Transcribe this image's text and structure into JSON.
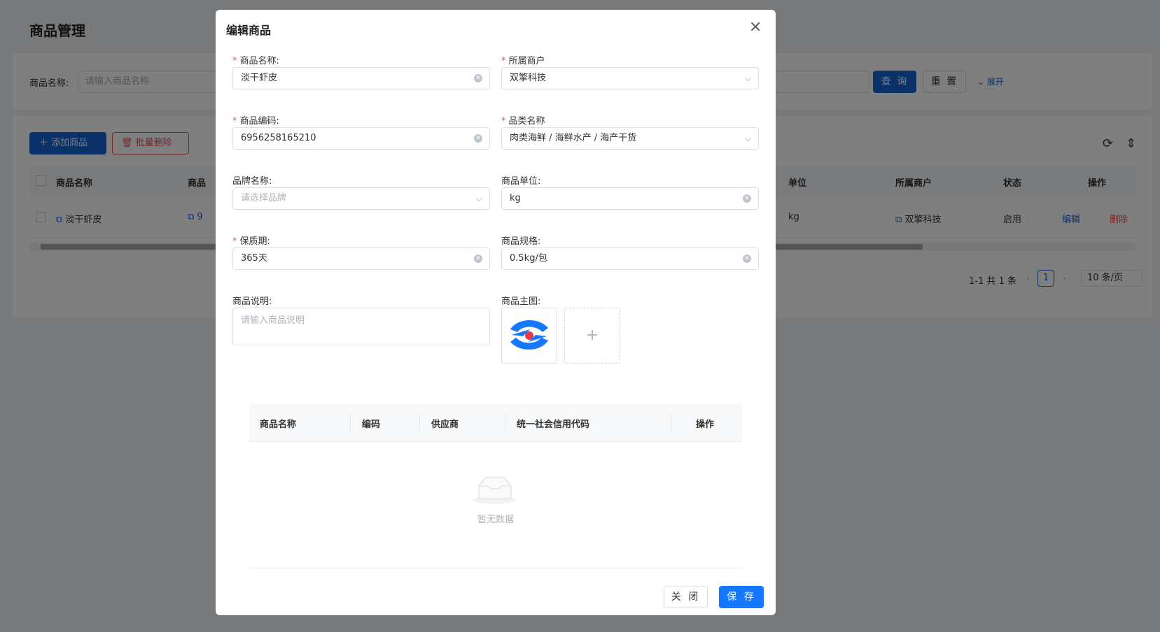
{
  "page": {
    "title": "商品管理",
    "search": {
      "label": "商品名称:",
      "placeholder": "请输入商品名称",
      "query_label": "查 询",
      "reset_label": "重 置",
      "expand_label": "展开"
    },
    "toolbar": {
      "add_label": "添加商品",
      "batch_delete_label": "批量删除"
    },
    "table": {
      "headers": [
        "商品名称",
        "商品",
        "单位",
        "所属商户",
        "状态",
        "操作"
      ],
      "rows": [
        {
          "name": "淡干虾皮",
          "code_prefix": "9",
          "unit": "kg",
          "merchant": "双擎科技",
          "status": "启用",
          "edit": "编辑",
          "delete": "删除"
        }
      ]
    },
    "pagination": {
      "summary": "1-1 共 1 条",
      "current_page": "1",
      "page_size": "10 条/页"
    }
  },
  "modal": {
    "title": "编辑商品",
    "fields": {
      "name": {
        "label": "商品名称:",
        "value": "淡干虾皮"
      },
      "merchant": {
        "label": "所属商户",
        "value": "双擎科技"
      },
      "code": {
        "label": "商品编码:",
        "value": "6956258165210"
      },
      "category": {
        "label": "品类名称",
        "value": "肉类海鲜 / 海鲜水产 / 海产干货"
      },
      "brand": {
        "label": "品牌名称:",
        "placeholder": "请选择品牌"
      },
      "unit": {
        "label": "商品单位:",
        "value": "kg"
      },
      "shelf_life": {
        "label": "保质期:",
        "value": "365天"
      },
      "spec": {
        "label": "商品规格:",
        "value": "0.5kg/包"
      },
      "description": {
        "label": "商品说明:",
        "placeholder": "请输入商品说明"
      },
      "main_image": {
        "label": "商品主图:",
        "add": "+"
      }
    },
    "sub_table": {
      "headers": [
        "商品名称",
        "编码",
        "供应商",
        "统一社会信用代码",
        "操作"
      ],
      "empty_text": "暂无数据"
    },
    "buttons": {
      "close": "关 闭",
      "save": "保 存"
    }
  },
  "colors": {
    "primary": "#1464d2",
    "danger": "#e35656",
    "save": "#1677ff"
  }
}
